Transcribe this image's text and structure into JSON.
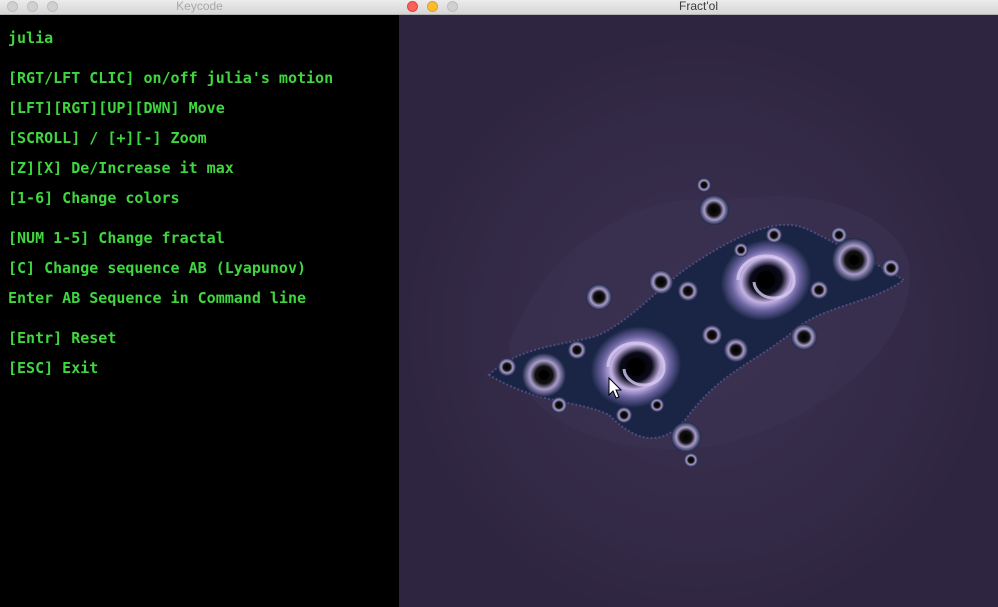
{
  "keycode_window": {
    "title": "Keycode",
    "lines": [
      "julia",
      "[RGT/LFT CLIC] on/off julia's motion",
      "[LFT][RGT][UP][DWN] Move",
      "[SCROLL] / [+][-] Zoom",
      "[Z][X] De/Increase it max",
      "[1-6] Change colors",
      "[NUM 1-5] Change fractal",
      "[C] Change sequence AB (Lyapunov)",
      "Enter AB Sequence in Command line",
      "[Entr] Reset",
      "[ESC] Exit"
    ]
  },
  "fractol_window": {
    "title": "Fract'ol",
    "fractal_name": "julia",
    "colors": {
      "background": "#2e2540",
      "halo": "#342b48",
      "body": "#1a2545",
      "highlight": "#c5b3e6",
      "core": "#000000"
    }
  },
  "colors": {
    "terminal_text": "#3fd63f",
    "terminal_background": "#000000"
  }
}
